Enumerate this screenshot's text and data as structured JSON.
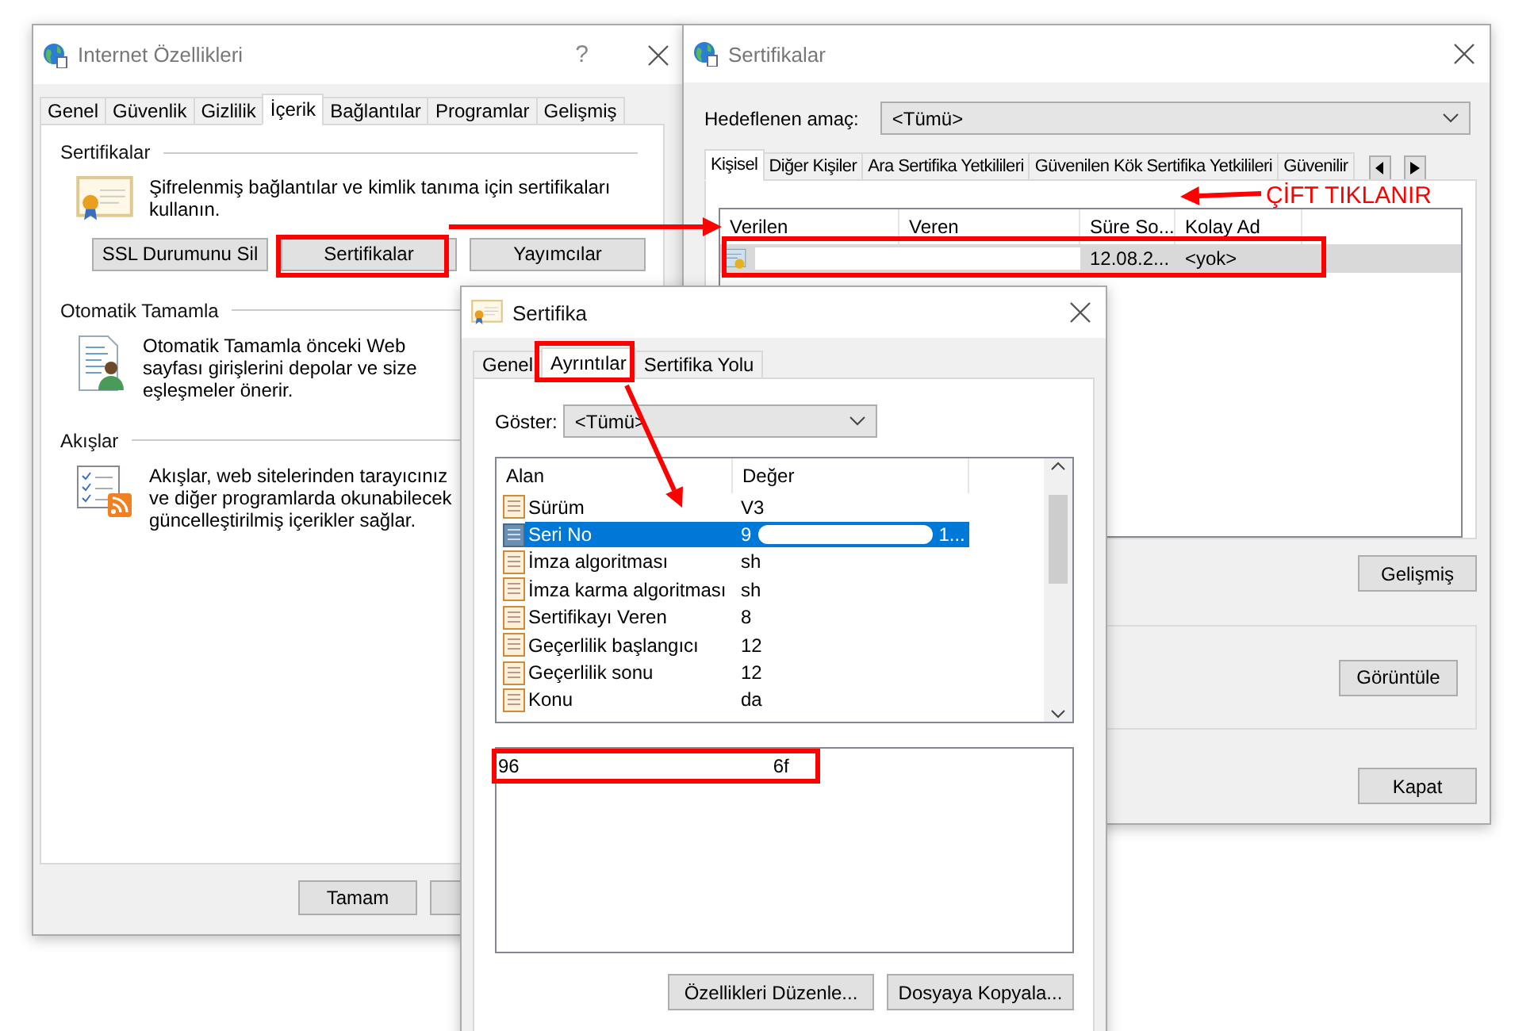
{
  "internet_options": {
    "title": "Internet Özellikleri",
    "help": "?",
    "tabs": [
      {
        "label": "Genel",
        "selected": false
      },
      {
        "label": "Güvenlik",
        "selected": false
      },
      {
        "label": "Gizlilik",
        "selected": false
      },
      {
        "label": "İçerik",
        "selected": true
      },
      {
        "label": "Bağlantılar",
        "selected": false
      },
      {
        "label": "Programlar",
        "selected": false
      },
      {
        "label": "Gelişmiş",
        "selected": false
      }
    ],
    "sections": [
      {
        "heading": "Sertifikalar",
        "kind": "certificate",
        "text": "Şifrelenmiş bağlantılar ve kimlik tanıma için sertifikaları kullanın.",
        "buttons": [
          "SSL Durumunu Sil",
          "Sertifikalar",
          "Yayımcılar"
        ]
      },
      {
        "heading": "Otomatik Tamamla",
        "kind": "autocomplete",
        "text": "Otomatik Tamamla önceki Web sayfası girişlerini depolar ve size eşleşmeler önerir."
      },
      {
        "heading": "Akışlar",
        "kind": "feeds",
        "text": "Akışlar, web sitelerinden tarayıcınız ve diğer programlarda okunabilecek güncelleştirilmiş içerikler sağlar."
      }
    ],
    "footer_buttons": [
      "Tamam"
    ]
  },
  "certificates": {
    "title": "Sertifikalar",
    "purpose_label": "Hedeflenen amaç:",
    "purpose_value": "<Tümü>",
    "tabs": [
      {
        "label": "Kişisel",
        "selected": true
      },
      {
        "label": "Diğer Kişiler",
        "selected": false
      },
      {
        "label": "Ara Sertifika Yetkilileri",
        "selected": false
      },
      {
        "label": "Güvenilen Kök Sertifika Yetkilileri",
        "selected": false
      },
      {
        "label": "Güvenilir",
        "selected": false
      }
    ],
    "columns": [
      "Verilen",
      "Veren",
      "Süre So...",
      "Kolay Ad"
    ],
    "rows": [
      {
        "expires": "12.08.2...",
        "friendly_name": "<yok>",
        "selected": true
      }
    ],
    "buttons": [
      "Gelişmiş",
      "Görüntüle",
      "Kapat"
    ]
  },
  "certificate": {
    "title": "Sertifika",
    "tabs": [
      {
        "label": "Genel",
        "selected": false
      },
      {
        "label": "Ayrıntılar",
        "selected": true
      },
      {
        "label": "Sertifika Yolu",
        "selected": false
      }
    ],
    "show_label": "Göster:",
    "show_value": "<Tümü>",
    "columns": [
      "Alan",
      "Değer"
    ],
    "fields": [
      {
        "field": "Sürüm",
        "value": "V3",
        "selected": false
      },
      {
        "field": "Seri No",
        "value": "9",
        "value_end": "1...",
        "selected": true
      },
      {
        "field": "İmza algoritması",
        "value": "sh",
        "selected": false
      },
      {
        "field": "İmza karma algoritması",
        "value": "sh",
        "selected": false
      },
      {
        "field": "Sertifikayı Veren",
        "value": "8",
        "selected": false
      },
      {
        "field": "Geçerlilik başlangıcı",
        "value": "12",
        "selected": false
      },
      {
        "field": "Geçerlilik sonu",
        "value": "12",
        "selected": false
      },
      {
        "field": "Konu",
        "value": "da",
        "selected": false
      }
    ],
    "value_text_start": "96",
    "value_text_end": "6f",
    "buttons": [
      "Özellikleri Düzenle...",
      "Dosyaya Kopyala..."
    ]
  },
  "annotation": {
    "label": "ÇİFT TIKLANIR"
  }
}
